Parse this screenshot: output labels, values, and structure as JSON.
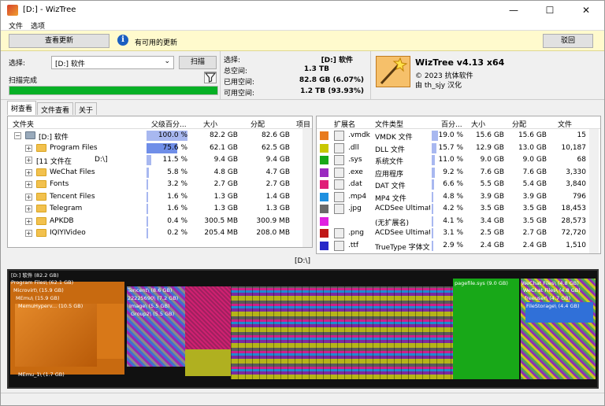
{
  "window": {
    "title": "[D:] - WizTree",
    "minimize_glyph": "—",
    "maximize_glyph": "☐",
    "close_glyph": "✕"
  },
  "menu": [
    "文件",
    "选项"
  ],
  "notify": {
    "check_update": "查看更新",
    "message": "有可用的更新",
    "dismiss": "驳回",
    "bg_color": "#fffacd"
  },
  "scan": {
    "select_label": "选择:",
    "drive": "[D:] 软件",
    "scan_button": "扫描",
    "status": "扫描完成",
    "progress": 1.0
  },
  "stats": {
    "select_label": "选择:",
    "select_value": "[D:] 软件",
    "total_label": "总空间:",
    "total_value": "1.3 TB",
    "used_label": "已用空间:",
    "used_value": "82.8 GB (6.07%)",
    "free_label": "可用空间:",
    "free_value": "1.2 TB (93.93%)"
  },
  "about": {
    "name": "WizTree v4.13 x64",
    "copyright": "© 2023 抗体软件",
    "translator": "由 th_sjy 汉化"
  },
  "tabs": [
    "树查看",
    "文件查看",
    "关于"
  ],
  "tree": {
    "columns": [
      "文件夹",
      "父级百分...",
      "大小",
      "分配",
      "项目"
    ],
    "rows": [
      {
        "name": "[D:] 软件",
        "pct": "100.0 %",
        "size": "82.2 GB",
        "alloc": "82.6 GB",
        "bar": 1.0,
        "icon": "drive-icon",
        "expand": "−",
        "sel": false
      },
      {
        "name": "Program Files",
        "pct": "75.6 %",
        "size": "62.1 GB",
        "alloc": "62.5 GB",
        "bar": 0.756,
        "icon": "folder-icon",
        "expand": "+",
        "sel": true
      },
      {
        "name": "[11 文件在",
        "name2": "D:\\]",
        "pct": "11.5 %",
        "size": "9.4 GB",
        "alloc": "9.4 GB",
        "bar": 0.115,
        "icon": "none",
        "expand": "+",
        "sel": false
      },
      {
        "name": "WeChat Files",
        "pct": "5.8 %",
        "size": "4.8 GB",
        "alloc": "4.7 GB",
        "bar": 0.058,
        "icon": "folder-icon",
        "expand": "+",
        "sel": false
      },
      {
        "name": "Fonts",
        "pct": "3.2 %",
        "size": "2.7 GB",
        "alloc": "2.7 GB",
        "bar": 0.032,
        "icon": "folder-icon",
        "expand": "+",
        "sel": false
      },
      {
        "name": "Tencent Files",
        "pct": "1.6 %",
        "size": "1.3 GB",
        "alloc": "1.4 GB",
        "bar": 0.016,
        "icon": "folder-icon",
        "expand": "+",
        "sel": false
      },
      {
        "name": "Telegram",
        "pct": "1.6 %",
        "size": "1.3 GB",
        "alloc": "1.3 GB",
        "bar": 0.016,
        "icon": "folder-icon",
        "expand": "+",
        "sel": false
      },
      {
        "name": "APKDB",
        "pct": "0.4 %",
        "size": "300.5 MB",
        "alloc": "300.9 MB",
        "bar": 0.004,
        "icon": "folder-icon",
        "expand": "+",
        "sel": false
      },
      {
        "name": "IQIYIVideo",
        "pct": "0.2 %",
        "size": "205.4 MB",
        "alloc": "208.0 MB",
        "bar": 0.002,
        "icon": "folder-icon",
        "expand": "+",
        "sel": false
      }
    ]
  },
  "files": {
    "columns": [
      "扩展名",
      "文件类型",
      "百分...",
      "大小",
      "分配",
      "文件"
    ],
    "rows": [
      {
        "ext": ".vmdk",
        "type": "VMDK 文件",
        "pct": "19.0 %",
        "size": "15.6 GB",
        "alloc": "15.6 GB",
        "count": "15",
        "color": "#e87a1d",
        "bar": 0.19,
        "icon": "vmdk-icon"
      },
      {
        "ext": ".dll",
        "type": "DLL 文件",
        "pct": "15.7 %",
        "size": "12.9 GB",
        "alloc": "13.0 GB",
        "count": "10,187",
        "color": "#c8c800",
        "bar": 0.157,
        "icon": "dll-icon"
      },
      {
        "ext": ".sys",
        "type": "系统文件",
        "pct": "11.0 %",
        "size": "9.0 GB",
        "alloc": "9.0 GB",
        "count": "68",
        "color": "#18a818",
        "bar": 0.11,
        "icon": "sys-icon"
      },
      {
        "ext": ".exe",
        "type": "应用程序",
        "pct": "9.2 %",
        "size": "7.6 GB",
        "alloc": "7.6 GB",
        "count": "3,330",
        "color": "#9a2bc0",
        "bar": 0.092,
        "icon": "exe-icon"
      },
      {
        "ext": ".dat",
        "type": "DAT 文件",
        "pct": "6.6 %",
        "size": "5.5 GB",
        "alloc": "5.4 GB",
        "count": "3,840",
        "color": "#e01e78",
        "bar": 0.066,
        "icon": "dat-icon"
      },
      {
        "ext": ".mp4",
        "type": "MP4 文件",
        "pct": "4.8 %",
        "size": "3.9 GB",
        "alloc": "3.9 GB",
        "count": "796",
        "color": "#1e90e0",
        "bar": 0.048,
        "icon": "mp4-icon"
      },
      {
        "ext": ".jpg",
        "type": "ACDSee Ultimate",
        "pct": "4.2 %",
        "size": "3.5 GB",
        "alloc": "3.5 GB",
        "count": "18,453",
        "color": "#6a6a6a",
        "bar": 0.042,
        "icon": "jpg-icon"
      },
      {
        "ext": "",
        "type": "(无扩展名)",
        "pct": "4.1 %",
        "size": "3.4 GB",
        "alloc": "3.5 GB",
        "count": "28,573",
        "color": "#e020e0",
        "bar": 0.041,
        "icon": "none"
      },
      {
        "ext": ".png",
        "type": "ACDSee Ultimate",
        "pct": "3.1 %",
        "size": "2.5 GB",
        "alloc": "2.7 GB",
        "count": "72,720",
        "color": "#c01818",
        "bar": 0.031,
        "icon": "png-icon"
      },
      {
        "ext": ".ttf",
        "type": "TrueType 字体文",
        "pct": "2.9 %",
        "size": "2.4 GB",
        "alloc": "2.4 GB",
        "count": "1,510",
        "color": "#2828c8",
        "bar": 0.029,
        "icon": "ttf-icon"
      }
    ]
  },
  "treemap": {
    "path": "[D:\\]",
    "labels": {
      "root": "[D:] 软件 (82.2 GB)",
      "program_files": "Program Files\\ (62.1 GB)",
      "microvirt": "Microvirt\\ (15.9 GB)",
      "memu": "MEmu\\ (15.9 GB)",
      "memuhyperv": "MemuHyperv... (10.5 GB)",
      "memu1": "MEmu_1\\ (1.7 GB)",
      "tencent": "Tencent\\ (8.6 GB)",
      "tencent_id": "22225690\\ (7.2 GB)",
      "image": "Image\\ (5.5 GB)",
      "group2": "Group2\\ (5.5 GB)",
      "pagefile": "pagefile.sys (9.0 GB)",
      "wechat": "WeChat Files\\ (4.8 GB)",
      "wechat2": "WeChat Files\\ (4.8 GB)",
      "freeuser": "freeuser\\ (4.7 GB)",
      "filestorage": "FileStorage\\ (4.4 GB)"
    }
  }
}
